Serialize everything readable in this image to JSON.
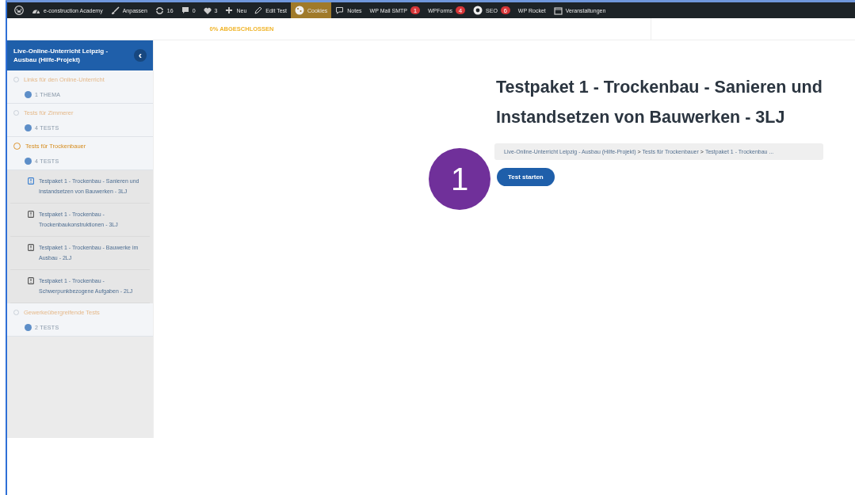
{
  "admin_bar": [
    {
      "kind": "logo"
    },
    {
      "kind": "dashboard",
      "label": "e-construction Academy"
    },
    {
      "kind": "brush",
      "label": "Anpassen"
    },
    {
      "kind": "refresh",
      "label": "16"
    },
    {
      "kind": "comment",
      "label": "0"
    },
    {
      "kind": "heart",
      "label": "3"
    },
    {
      "kind": "plus",
      "label": "Neu"
    },
    {
      "kind": "pencil",
      "label": "Edit Test"
    },
    {
      "kind": "cookie",
      "label": "Cookies",
      "highlighted": true
    },
    {
      "kind": "chat",
      "label": "Notes"
    },
    {
      "kind": "text",
      "label": "WP Mail SMTP",
      "badge": "1"
    },
    {
      "kind": "text",
      "label": "WPForms",
      "badge": "4"
    },
    {
      "kind": "seo",
      "label": "SEO",
      "badge": "6"
    },
    {
      "kind": "text",
      "label": "WP Rocket"
    },
    {
      "kind": "calendar",
      "label": "Veranstaltungen"
    }
  ],
  "progress": "0% ABGESCHLOSSEN",
  "sidebar": {
    "course_title": "Live-Online-Unterricht Leipzig - Ausbau (Hilfe-Projekt)",
    "collapse": "‹",
    "sections": [
      {
        "title": "Links für den Online-Unterricht",
        "count": "1 THEMA",
        "active": false
      },
      {
        "title": "Tests für Zimmerer",
        "count": "4 TESTS",
        "active": false
      },
      {
        "title": "Tests für Trockenbauer",
        "count": "4 TESTS",
        "active": true,
        "lessons": [
          {
            "title": "Testpaket 1 - Trockenbau - Sanieren und Instandsetzen von Bauwerken - 3LJ",
            "selected": true
          },
          {
            "title": "Testpaket 1 - Trockenbau - Trockenbaukonstruktionen - 3LJ",
            "selected": false
          },
          {
            "title": "Testpaket 1 - Trockenbau - Bauwerke im Ausbau - 2LJ",
            "selected": false
          },
          {
            "title": "Testpaket 1 - Trockenbau - Schwerpunkbezogene Aufgaben - 2LJ",
            "selected": false
          }
        ]
      },
      {
        "title": "Gewerkeübergreifende Tests",
        "count": "2 TESTS",
        "active": false
      }
    ]
  },
  "content": {
    "title": "Testpaket 1 - Trockenbau - Sanieren und Instandsetzen von Bauwerken - 3LJ",
    "breadcrumb": [
      "Live-Online-Unterricht Leipzig - Ausbau (Hilfe-Projekt)",
      "Tests für Trockenbauer",
      "Testpaket 1 - Trockenbau ..."
    ],
    "breadcrumb_separator": ">",
    "button": "Test starten"
  },
  "annotation": "1"
}
